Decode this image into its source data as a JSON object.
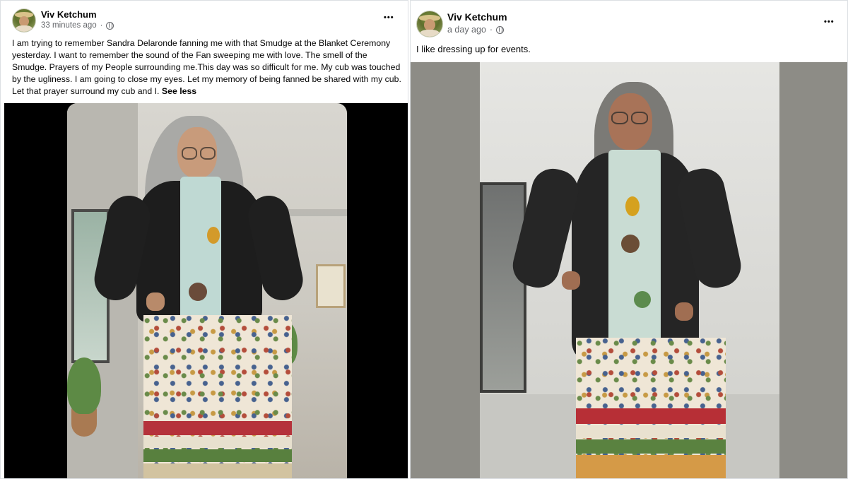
{
  "posts": [
    {
      "author": "Viv Ketchum",
      "timestamp": "33 minutes ago",
      "text": "I am trying to remember Sandra Delaronde fanning me with that Smudge at the Blanket Ceremony yesterday. I want to remember the sound of the Fan sweeping me with love. The smell of the Smudge. Prayers of my People surrounding me.This day was so difficult for me. My cub was touched by the ugliness. I am going to close my eyes. Let my memory of being fanned be shared with my cub. Let that prayer surround my cub and I.",
      "see_less": "See less",
      "more_icon": "•••",
      "image": "illustrated-portrait"
    },
    {
      "author": "Viv Ketchum",
      "timestamp": "a day ago",
      "text": "I like dressing up for events.",
      "more_icon": "•••",
      "image": "photo-portrait"
    }
  ],
  "icons": {
    "audience": "globe-icon",
    "more": "more-options-icon"
  },
  "colors": {
    "author": "#050505",
    "meta": "#65676b",
    "left_media_bg": "#000000",
    "right_media_bg": "#8d8c86"
  }
}
